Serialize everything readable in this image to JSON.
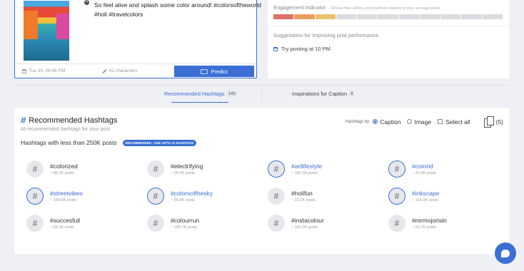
{
  "composer": {
    "caption": "So feel alive and splash some color around! #colorsoftheworld #holi #travelcolors",
    "date": "Tue 30, 06:46 PM",
    "characters": "81 characters",
    "predict_label": "Predict"
  },
  "performance": {
    "indicator_label": "Engagement Indicator",
    "indicator_sub": "- Shows how will the post perform relative to your average posts",
    "bar_colors": [
      "#e0706a",
      "#e8a060",
      "#ecc070",
      "#d9dbe0",
      "#d9dbe0",
      "#d9dbe0",
      "#d9dbe0",
      "#d9dbe0",
      "#d9dbe0",
      "#d9dbe0",
      "#d9dbe0"
    ],
    "suggestions_title": "Suggestions for improving post performance",
    "suggestion": "Try posting at 10 PM"
  },
  "tabs": {
    "recommended": {
      "label": "Recommended Hashtags",
      "count": "143"
    },
    "inspirations": {
      "label": "Inspirations for Caption",
      "count": "8"
    }
  },
  "panel": {
    "title": "Recommended Hashtags",
    "subtitle": "AI-recommended hashtags for your post",
    "range_title": "Hashtags with less than 250K posts",
    "badge": "RECOMMENDED - USE UPTO 12 HASHTAGS",
    "hashtags_by": "Hashtags by",
    "caption_option": "Caption",
    "image_option": "Image",
    "select_all": "Select all",
    "selected_count": "(5)"
  },
  "hashtags": [
    {
      "name": "#colorized",
      "posts": "~ 85.1K posts",
      "recommended": false
    },
    {
      "name": "#electrifying",
      "posts": "~ 56.9K posts",
      "recommended": false
    },
    {
      "name": "#artlifestyle",
      "posts": "~ 182.3K posts",
      "recommended": true
    },
    {
      "name": "#colorid",
      "posts": "~ 21.4K posts",
      "recommended": true
    },
    {
      "name": "#streetvibes",
      "posts": "~ 159.6K posts",
      "recommended": true
    },
    {
      "name": "#colorsofthesky",
      "posts": "~ 85.4K posts",
      "recommended": true
    },
    {
      "name": "#holifun",
      "posts": "~ 22.2K posts",
      "recommended": false
    },
    {
      "name": "#inkscape",
      "posts": "~ 131.0K posts",
      "recommended": true
    },
    {
      "name": "#succesfull",
      "posts": "~ 56.3K posts",
      "recommended": false
    },
    {
      "name": "#colourrun",
      "posts": "~ 200.7K posts",
      "recommended": false
    },
    {
      "name": "#instacolour",
      "posts": "~ 242.0K posts",
      "recommended": false
    },
    {
      "name": "#mrmojorisin",
      "posts": "~ 61.7K posts",
      "recommended": false
    }
  ]
}
